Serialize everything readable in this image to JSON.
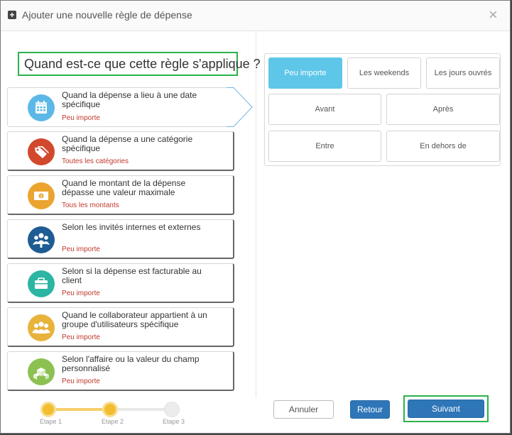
{
  "dialog": {
    "title": "Ajouter une nouvelle règle de dépense",
    "title_icon": "plus-square-icon",
    "close_icon": "close-icon",
    "close_glyph": "×"
  },
  "question": "Quand est-ce que cette règle s'applique ?",
  "cards": [
    {
      "title": "Quand la dépense a lieu à une date spécifique",
      "subtitle": "Peu importe",
      "icon": "calendar-icon",
      "icon_color": "#5cb8e6",
      "active": true
    },
    {
      "title": "Quand la dépense a une catégorie spécifique",
      "subtitle": "Toutes les catégories",
      "icon": "tags-icon",
      "icon_color": "#d2482c"
    },
    {
      "title": "Quand le montant de la dépense dépasse une valeur maximale",
      "subtitle": "Tous les montants",
      "icon": "money-icon",
      "icon_color": "#eba430"
    },
    {
      "title": "Selon les invités internes et externes",
      "subtitle": "Peu importe",
      "icon": "guests-icon",
      "icon_color": "#1f5c93"
    },
    {
      "title": "Selon si la dépense est facturable au client",
      "subtitle": "Peu importe",
      "icon": "briefcase-icon",
      "icon_color": "#2db5a3"
    },
    {
      "title": "Quand le collaborateur appartient à un groupe d'utilisateurs spécifique",
      "subtitle": "Peu importe",
      "icon": "user-group-icon",
      "icon_color": "#e8b33b"
    },
    {
      "title": "Selon l'affaire ou la valeur du champ personnalisé",
      "subtitle": "Peu importe",
      "icon": "boxes-icon",
      "icon_color": "#8cc152"
    }
  ],
  "options": {
    "row1": [
      "Peu importe",
      "Les weekends",
      "Les jours ouvrés"
    ],
    "row2": [
      "Avant",
      "Après"
    ],
    "row3": [
      "Entre",
      "En dehors de"
    ],
    "selected": "Peu importe",
    "selected_color": "#5ec6e8"
  },
  "stepper": {
    "steps": [
      "Etape 1",
      "Etape 2",
      "Etape 3"
    ],
    "current": 2
  },
  "buttons": {
    "cancel": "Annuler",
    "back": "Retour",
    "next": "Suivant"
  },
  "colors": {
    "highlight_border": "#2bb24c",
    "primary": "#2e76b7",
    "subtitle": "#c0392b"
  }
}
